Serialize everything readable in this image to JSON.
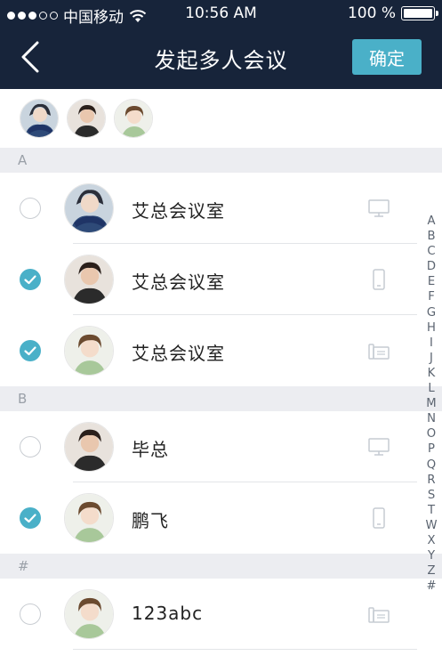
{
  "status_bar": {
    "carrier": "中国移动",
    "time": "10:56 AM",
    "battery": "100 %"
  },
  "navbar": {
    "title": "发起多人会议",
    "confirm_label": "确定"
  },
  "selected_count_shown": 3,
  "sections": [
    {
      "letter": "A",
      "rows": [
        {
          "name": "艾总会议室",
          "checked": false,
          "device": "desktop-icon",
          "avatar": "avatar-1"
        },
        {
          "name": "艾总会议室",
          "checked": true,
          "device": "phone-icon",
          "avatar": "avatar-2"
        },
        {
          "name": "艾总会议室",
          "checked": true,
          "device": "deskphone-icon",
          "avatar": "avatar-3"
        }
      ]
    },
    {
      "letter": "B",
      "rows": [
        {
          "name": "毕总",
          "checked": false,
          "device": "desktop-icon",
          "avatar": "avatar-2"
        },
        {
          "name": "鹏飞",
          "checked": true,
          "device": "phone-icon",
          "avatar": "avatar-3"
        }
      ]
    },
    {
      "letter": "#",
      "rows": [
        {
          "name": "123abc",
          "checked": false,
          "device": "deskphone-icon",
          "avatar": "avatar-3"
        }
      ]
    }
  ],
  "index_letters": [
    "A",
    "B",
    "C",
    "D",
    "E",
    "F",
    "G",
    "H",
    "I",
    "J",
    "K",
    "L",
    "M",
    "N",
    "O",
    "P",
    "Q",
    "R",
    "S",
    "T",
    "W",
    "X",
    "Y",
    "Z",
    "#"
  ],
  "colors": {
    "navbar_bg": "#17243a",
    "accent": "#4ab0c8",
    "section_bg": "#ecedf1"
  }
}
